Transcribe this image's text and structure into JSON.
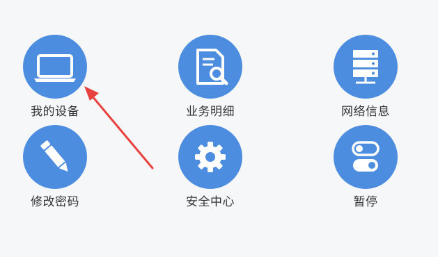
{
  "menu": {
    "items": [
      {
        "label": "我的设备",
        "icon": "laptop-icon"
      },
      {
        "label": "业务明细",
        "icon": "document-search-icon"
      },
      {
        "label": "网络信息",
        "icon": "server-icon"
      },
      {
        "label": "修改密码",
        "icon": "pencil-icon"
      },
      {
        "label": "安全中心",
        "icon": "gear-icon"
      },
      {
        "label": "暂停",
        "icon": "toggle-icon"
      }
    ]
  },
  "colors": {
    "accent": "#4d8de0",
    "background": "#f6f7f9",
    "text": "#333333",
    "arrow": "#e8423f"
  }
}
